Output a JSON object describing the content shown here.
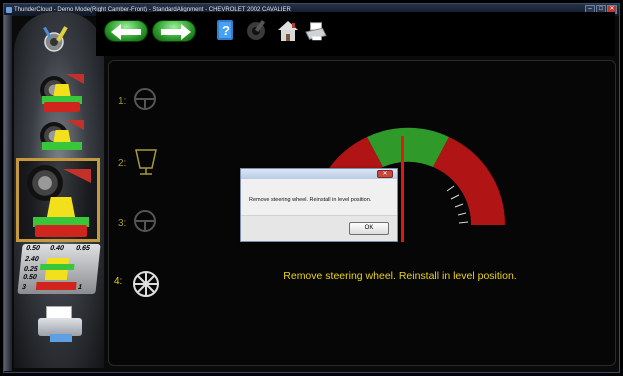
{
  "window": {
    "title": "ThunderCloud - Demo Mode(Right Camber-Front) - StandardAlignment - CHEVROLET 2002 CAVALIER",
    "controls": [
      "–",
      "□",
      "✕"
    ]
  },
  "toolbar": {
    "back_icon": "back-arrow-icon",
    "forward_icon": "forward-arrow-icon",
    "icons": [
      "help-book-icon",
      "settings-disabled-icon",
      "home-icon",
      "print-icon"
    ]
  },
  "sidebar": {
    "specs": [
      "0.50",
      "0.40",
      "0.65",
      "2.40",
      "0.25",
      "0.50",
      "3",
      "1"
    ],
    "items": [
      "tools-icon",
      "wheel-camber-icon",
      "wheel-camber-icon",
      "wheel-camber-selected-icon",
      "spec-chart-icon",
      "printer-icon"
    ]
  },
  "steps": [
    {
      "num": "1:",
      "icon": "steering-wheel-icon"
    },
    {
      "num": "2:",
      "icon": "steering-lock-icon"
    },
    {
      "num": "3:",
      "icon": "steering-wheel-icon"
    },
    {
      "num": "4:",
      "icon": "wheel-rim-icon"
    }
  ],
  "instruction": "Remove steering wheel. Reinstall in level position.",
  "dialog": {
    "message": "Remove steering wheel. Reinstall in level position.",
    "ok_label": "OK",
    "close_label": "✕"
  },
  "colors": {
    "gauge_red": "#b01414",
    "gauge_green": "#2f9a2a",
    "instruction": "#e8d21a",
    "selected_border": "#c49a3c"
  }
}
